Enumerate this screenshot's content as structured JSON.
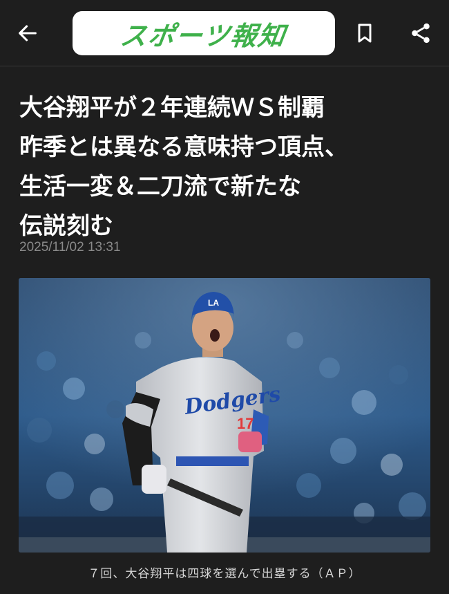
{
  "header": {
    "logo_text": "スポーツ報知",
    "back_icon": "arrow-left-icon",
    "bookmark_icon": "bookmark-icon",
    "share_icon": "share-icon",
    "logo_color": "#3fb14b"
  },
  "article": {
    "headline_lines": [
      "大谷翔平が２年連続ＷＳ制覇",
      "昨季とは異なる意味持つ頂点、",
      "生活一変＆二刀流で新たな",
      "伝説刻む"
    ],
    "timestamp": "2025/11/02 13:31",
    "photo": {
      "jersey_text": "Dodgers",
      "number": "17",
      "helmet_logo": "LA",
      "caption": "７回、大谷翔平は四球を選んで出塁する（ＡＰ）"
    }
  }
}
